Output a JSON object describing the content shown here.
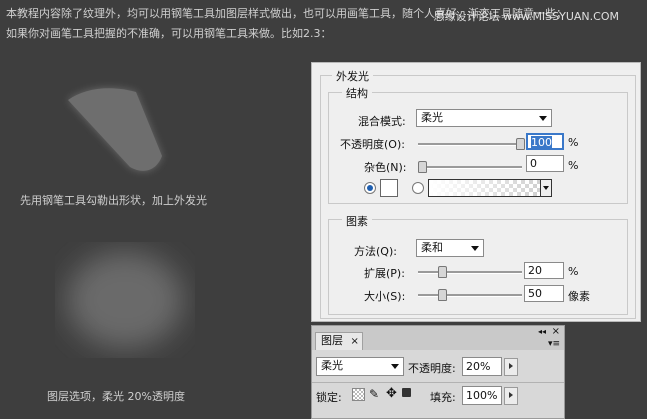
{
  "tutorial": {
    "line1": "本教程内容除了纹理外，均可以用钢笔工具加图层样式做出，也可以用画笔工具，随个人喜好，渐变工具随意一些；",
    "line2": "如果你对画笔工具把握的不准确，可以用钢笔工具来做。比如2.3："
  },
  "watermark": "思缘设计论坛 www.MISSYUAN.COM",
  "captions": {
    "shape": "先用钢笔工具勾勒出形状，加上外发光",
    "layer": "图层选项，柔光 20%透明度"
  },
  "outer_glow": {
    "title": "外发光",
    "structure": {
      "title": "结构",
      "blend_mode_label": "混合模式:",
      "blend_mode_value": "柔光",
      "opacity_label": "不透明度(O):",
      "opacity_value": "100",
      "opacity_unit": "%",
      "opacity_level": 1.0,
      "noise_label": "杂色(N):",
      "noise_value": "0",
      "noise_unit": "%",
      "noise_level": 0.0
    },
    "elements": {
      "title": "图素",
      "technique_label": "方法(Q):",
      "technique_value": "柔和",
      "spread_label": "扩展(P):",
      "spread_value": "20",
      "spread_unit": "%",
      "spread_level": 0.2,
      "size_label": "大小(S):",
      "size_value": "50",
      "size_unit": "像素",
      "size_level": 0.2
    }
  },
  "layers_panel": {
    "tab": "图层",
    "blend_mode": "柔光",
    "opacity_label": "不透明度:",
    "opacity_value": "20%",
    "lock_label": "锁定:",
    "fill_label": "填充:",
    "fill_value": "100%"
  }
}
